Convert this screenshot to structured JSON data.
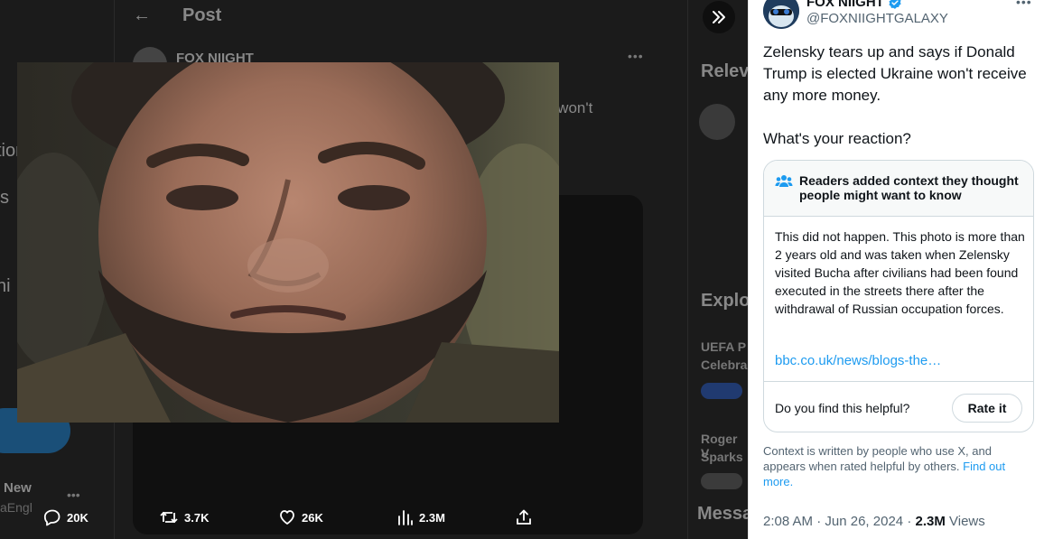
{
  "background": {
    "nav_fragments": [
      "tion",
      "s",
      "ni"
    ],
    "account_name": "New",
    "account_handle": "aEngl",
    "header_title": "Post",
    "author_name": "FOX NIIGHT",
    "tweet_fragment": "e won't",
    "right_headings": [
      "Relev",
      "Explo",
      "Messa"
    ],
    "right_items": [
      "UEFA P",
      "Celebra",
      "Roger V",
      "Sparks"
    ]
  },
  "actions": {
    "replies": "20K",
    "reposts": "3.7K",
    "likes": "26K",
    "views": "2.3M"
  },
  "panel": {
    "author_name": "FOX NIIGHT",
    "author_handle": "@FOXNIIGHTGALAXY",
    "tweet_line1": "Zelensky tears up and says if Donald Trump is elected Ukraine won't receive any more money.",
    "tweet_line2": "What's your reaction?",
    "note": {
      "heading": "Readers added context they thought people might want to know",
      "body": "This did not happen. This photo is more than 2 years old and was taken when Zelensky visited Bucha after civilians had been found executed in the streets there after the withdrawal of Russian occupation forces.",
      "link": "bbc.co.uk/news/blogs-the…",
      "question": "Do you find this helpful?",
      "rate_label": "Rate it"
    },
    "context_text": "Context is written by people who use X, and appears when rated helpful by others.",
    "context_link": "Find out more.",
    "time": "2:08 AM",
    "date": "Jun 26, 2024",
    "views_count": "2.3M",
    "views_label": "Views"
  },
  "colors": {
    "accent": "#1d9bf0",
    "verified": "#1d9bf0"
  }
}
